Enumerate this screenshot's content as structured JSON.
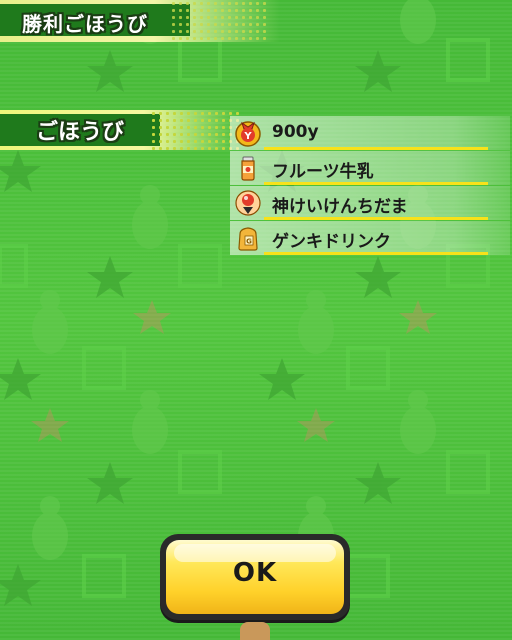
{
  "header": {
    "title": "勝利ごほうび"
  },
  "rewards": {
    "label": "ごほうび",
    "items": [
      {
        "label": "900y",
        "icon": "money-bag-icon"
      },
      {
        "label": "フルーツ牛乳",
        "icon": "fruit-milk-icon"
      },
      {
        "label": "神けいけんちだま",
        "icon": "exp-orb-icon"
      },
      {
        "label": "ゲンキドリンク",
        "icon": "energy-drink-icon"
      }
    ]
  },
  "ok_button": {
    "label": "OK"
  },
  "colors": {
    "background": "#4cc13a",
    "accent": "#f7e21a",
    "title_band": "#1f7a1c",
    "button": "#ffd12a"
  }
}
